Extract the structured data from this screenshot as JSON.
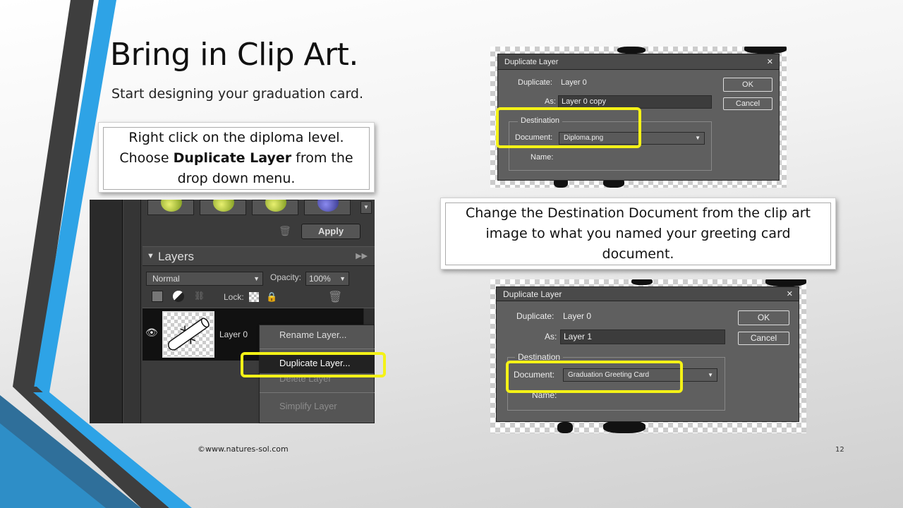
{
  "slide": {
    "title": "Bring in Clip Art.",
    "subtitle": "Start designing your graduation card.",
    "callout1": {
      "line1": "Right click on the diploma level.",
      "line2_pre": "Choose ",
      "line2_bold": "Duplicate Layer",
      "line2_post": " from the",
      "line3": "drop down menu."
    },
    "callout2": "Change the Destination Document from the clip art image to what you named your greeting card document.",
    "footer_left": "©www.natures-sol.com",
    "page_number": "12",
    "accent_colors": {
      "blue": "#2ea3e6",
      "dark": "#3a3a3a",
      "highlight": "#f4f217"
    }
  },
  "layers_panel": {
    "apply_label": "Apply",
    "panel_title": "Layers",
    "blend_mode": "Normal",
    "opacity_label": "Opacity:",
    "opacity_value": "100%",
    "lock_label": "Lock:",
    "layer_name": "Layer 0",
    "context_menu": {
      "items": [
        "Rename Layer...",
        "Duplicate Layer...",
        "Delete Layer",
        "Simplify Layer"
      ]
    }
  },
  "dialog1": {
    "title": "Duplicate Layer",
    "duplicate_label": "Duplicate:",
    "duplicate_value": "Layer 0",
    "as_label": "As:",
    "as_value": "Layer 0 copy",
    "ok_label": "OK",
    "cancel_label": "Cancel",
    "destination_label": "Destination",
    "document_label": "Document:",
    "document_value": "Diploma.png",
    "name_label": "Name:"
  },
  "dialog2": {
    "title": "Duplicate Layer",
    "duplicate_label": "Duplicate:",
    "duplicate_value": "Layer 0",
    "as_label": "As:",
    "as_value": "Layer 1",
    "ok_label": "OK",
    "cancel_label": "Cancel",
    "destination_label": "Destination",
    "document_label": "Document:",
    "document_value": "Graduation Greeting Card",
    "name_label": "Name:"
  }
}
